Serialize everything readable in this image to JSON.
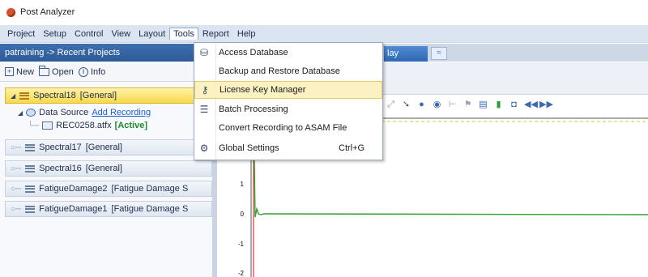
{
  "window": {
    "title": "Post Analyzer"
  },
  "menubar": {
    "items": [
      "Project",
      "Setup",
      "Control",
      "View",
      "Layout",
      "Tools",
      "Report",
      "Help"
    ],
    "open_index": 5
  },
  "left_panel": {
    "header": "patraining -> Recent Projects",
    "toolbar": {
      "new_label": "New",
      "open_label": "Open",
      "info_label": "Info"
    },
    "tree": {
      "selected": {
        "name": "Spectral18",
        "type": "[General]"
      },
      "data_source_label": "Data Source",
      "add_recording_label": "Add Recording",
      "recording_file": "REC0258.atfx",
      "recording_status": "[Active]",
      "nodes": [
        {
          "name": "Spectral17",
          "type": "[General]"
        },
        {
          "name": "Spectral16",
          "type": "[General]"
        },
        {
          "name": "FatigueDamage2",
          "type": "[Fatigue Damage S"
        },
        {
          "name": "FatigueDamage1",
          "type": "[Fatigue Damage S"
        }
      ]
    }
  },
  "tools_menu": {
    "items": [
      {
        "label": "Access Database",
        "icon": "database-icon",
        "shortcut": ""
      },
      {
        "label": "Backup and Restore Database",
        "icon": "",
        "shortcut": ""
      },
      {
        "label": "License Key Manager",
        "icon": "key-icon",
        "shortcut": "",
        "highlighted": true
      },
      {
        "label": "Batch Processing",
        "icon": "list-icon",
        "shortcut": ""
      },
      {
        "label": "Convert Recording to ASAM File",
        "icon": "",
        "shortcut": ""
      },
      {
        "label": "Global Settings",
        "icon": "gear-icon",
        "shortcut": "Ctrl+G"
      }
    ]
  },
  "right_panel": {
    "tab_label": "lay",
    "y_ticks": [
      "1",
      "0",
      "-1",
      "-2"
    ]
  },
  "colors": {
    "accent": "#2d5a98",
    "highlight": "#fcf1c3",
    "selected_node": "#f6d94d",
    "signal": "#2ea02e",
    "cursor": "#e03030"
  }
}
